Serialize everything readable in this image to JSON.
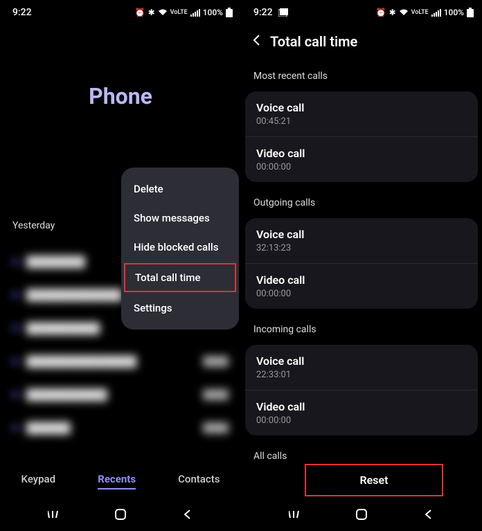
{
  "left": {
    "status": {
      "time": "9:22",
      "battery": "100%"
    },
    "title": "Phone",
    "date": "Yesterday",
    "popup": {
      "delete": "Delete",
      "show_messages": "Show messages",
      "hide_blocked": "Hide blocked calls",
      "total_call_time": "Total call time",
      "settings": "Settings"
    },
    "tabs": {
      "keypad": "Keypad",
      "recents": "Recents",
      "contacts": "Contacts"
    }
  },
  "right": {
    "status": {
      "time": "9:22",
      "battery": "100%"
    },
    "title": "Total call time",
    "sections": {
      "most_recent": {
        "label": "Most recent calls",
        "voice": {
          "label": "Voice call",
          "value": "00:45:21"
        },
        "video": {
          "label": "Video call",
          "value": "00:00:00"
        }
      },
      "outgoing": {
        "label": "Outgoing calls",
        "voice": {
          "label": "Voice call",
          "value": "32:13:23"
        },
        "video": {
          "label": "Video call",
          "value": "00:00:00"
        }
      },
      "incoming": {
        "label": "Incoming calls",
        "voice": {
          "label": "Voice call",
          "value": "22:33:01"
        },
        "video": {
          "label": "Video call",
          "value": "00:00:00"
        }
      },
      "all": {
        "label": "All calls"
      }
    },
    "reset": "Reset"
  }
}
